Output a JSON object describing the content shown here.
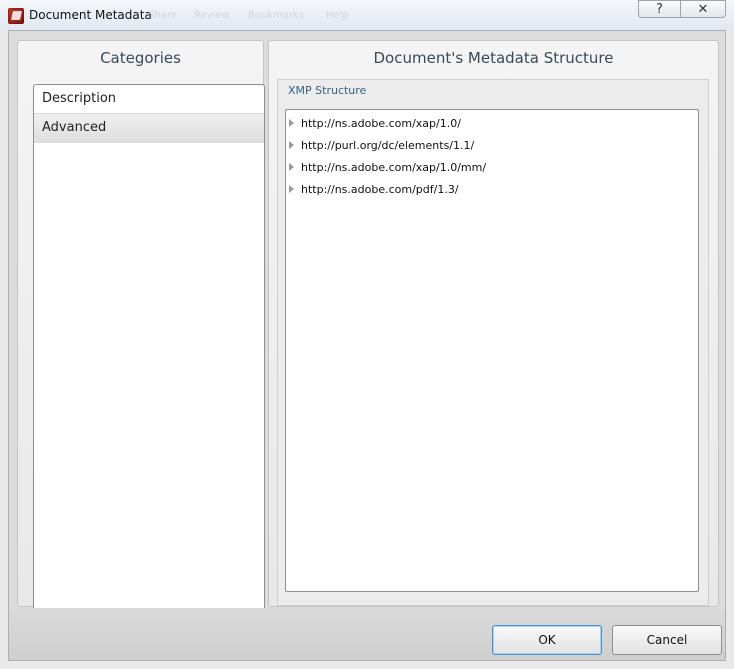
{
  "window": {
    "title": "Document Metadata",
    "background_menu": [
      "Share",
      "Review",
      "Bookmarks",
      "Help"
    ],
    "help_glyph": "?",
    "close_glyph": "✕"
  },
  "categories": {
    "title": "Categories",
    "items": [
      {
        "label": "Description",
        "selected": false
      },
      {
        "label": "Advanced",
        "selected": true
      }
    ]
  },
  "structure": {
    "title": "Document's Metadata Structure",
    "group_label": "XMP Structure",
    "nodes": [
      "http://ns.adobe.com/xap/1.0/",
      "http://purl.org/dc/elements/1.1/",
      "http://ns.adobe.com/xap/1.0/mm/",
      "http://ns.adobe.com/pdf/1.3/"
    ]
  },
  "buttons": {
    "ok": "OK",
    "cancel": "Cancel"
  }
}
